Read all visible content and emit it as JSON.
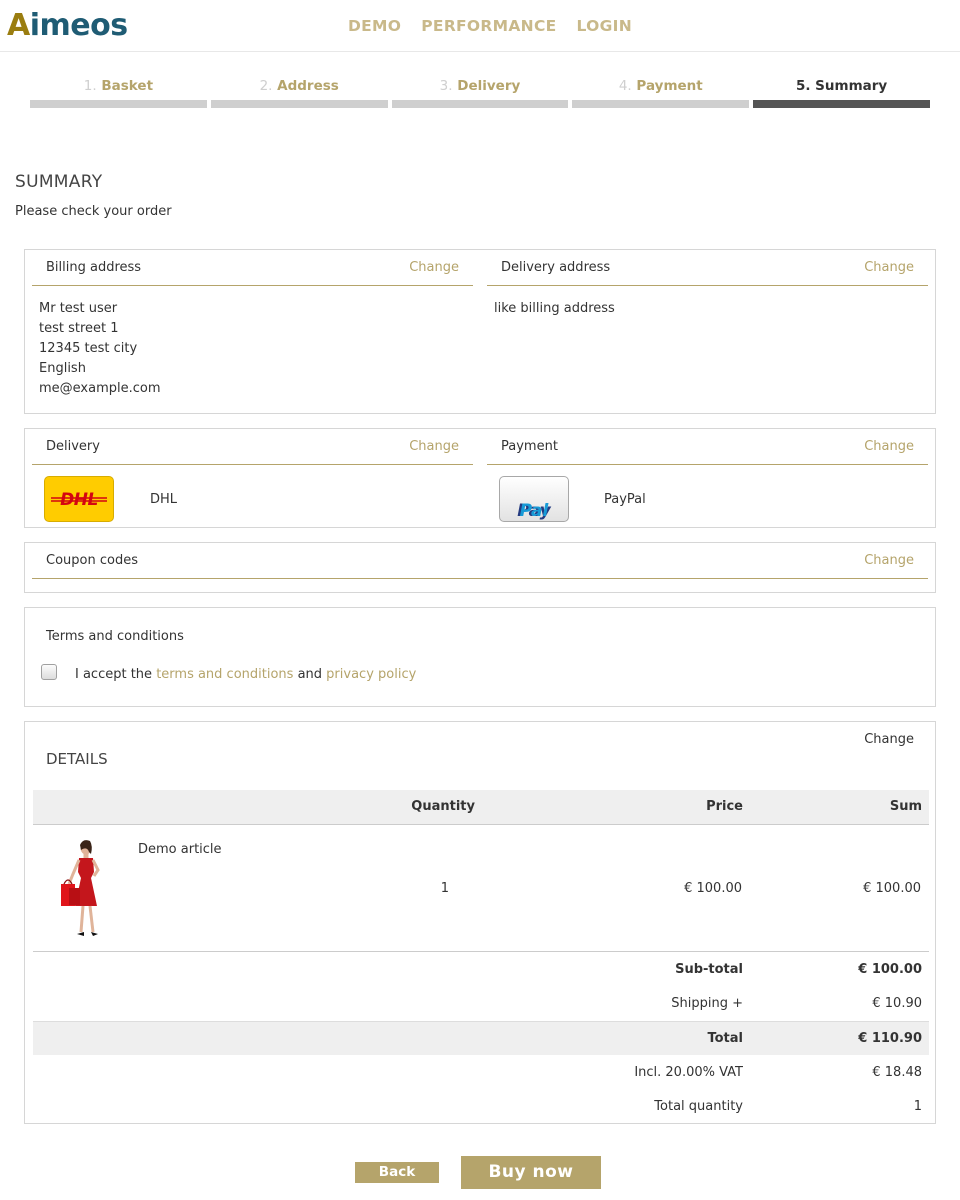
{
  "brand": {
    "logo_first": "A",
    "logo_rest": "imeos"
  },
  "nav": {
    "items": [
      "DEMO",
      "PERFORMANCE",
      "LOGIN"
    ]
  },
  "steps": [
    {
      "num": "1.",
      "label": "Basket"
    },
    {
      "num": "2.",
      "label": "Address"
    },
    {
      "num": "3.",
      "label": "Delivery"
    },
    {
      "num": "4.",
      "label": "Payment"
    },
    {
      "num": "5.",
      "label": "Summary"
    }
  ],
  "page": {
    "title": "SUMMARY",
    "subtitle": "Please check your order"
  },
  "change_label": "Change",
  "billing": {
    "title": "Billing address",
    "lines": [
      "Mr test user",
      "test street 1",
      "12345 test city",
      "English",
      "me@example.com"
    ]
  },
  "delivery_address": {
    "title": "Delivery address",
    "text": "like billing address"
  },
  "delivery": {
    "title": "Delivery",
    "service": "DHL",
    "logo_text": "DHL"
  },
  "payment": {
    "title": "Payment",
    "service": "PayPal",
    "logo_text_1": "Pay",
    "logo_text_2": "Pal"
  },
  "coupon": {
    "title": "Coupon codes"
  },
  "terms": {
    "title": "Terms and conditions",
    "text_1": "I accept the ",
    "link_terms": "terms and conditions",
    "text_2": " and ",
    "link_privacy": "privacy policy",
    "checked": false
  },
  "details": {
    "title": "DETAILS",
    "columns": {
      "quantity": "Quantity",
      "price": "Price",
      "sum": "Sum"
    },
    "items": [
      {
        "name": "Demo article",
        "quantity": "1",
        "price": "€ 100.00",
        "sum": "€ 100.00"
      }
    ],
    "totals": {
      "subtotal_label": "Sub-total",
      "subtotal": "€ 100.00",
      "shipping_label": "Shipping +",
      "shipping": "€ 10.90",
      "total_label": "Total",
      "total": "€ 110.90",
      "vat_label": "Incl. 20.00% VAT",
      "vat": "€ 18.48",
      "qty_label": "Total quantity",
      "qty": "1"
    }
  },
  "buttons": {
    "back": "Back",
    "buy": "Buy now"
  },
  "colors": {
    "accent": "#b5a46b",
    "step_inactive": "#cfcfcf",
    "step_active": "#555555",
    "logo_gold": "#9a7d10",
    "logo_blue": "#1f5c74"
  }
}
